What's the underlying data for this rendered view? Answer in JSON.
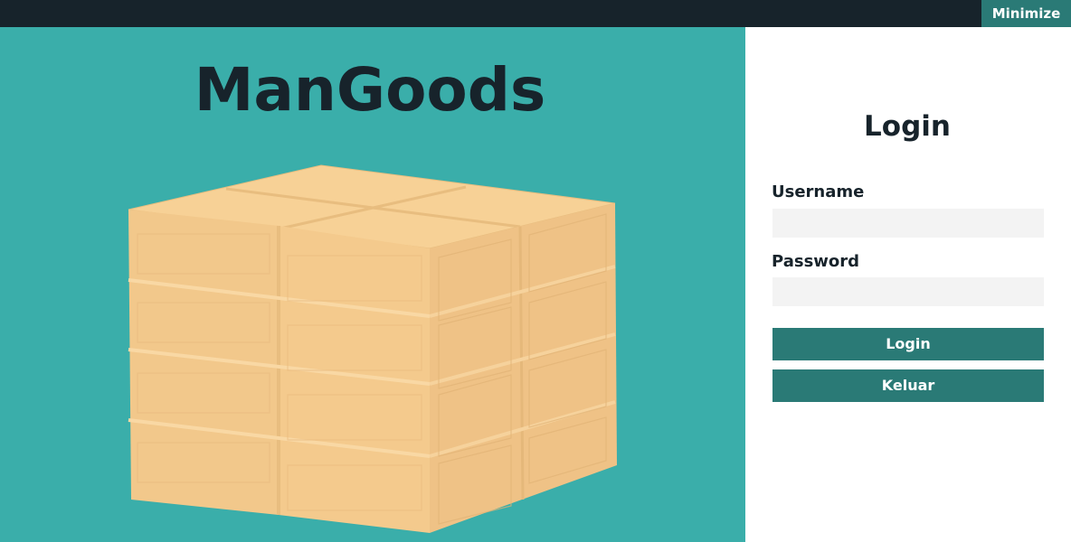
{
  "topbar": {
    "minimize_label": "Minimize"
  },
  "brand": {
    "title": "ManGoods",
    "illustration_icon": "stacked-wooden-crates-icon"
  },
  "login": {
    "title": "Login",
    "username_label": "Username",
    "username_value": "",
    "username_placeholder": "",
    "password_label": "Password",
    "password_value": "",
    "password_placeholder": "",
    "login_button": "Login",
    "exit_button": "Keluar"
  },
  "colors": {
    "topbar": "#17232b",
    "accent": "#2a7a76",
    "left_panel": "#3aaeaa",
    "input_bg": "#f3f3f3",
    "crate_light": "#f7cf94",
    "crate_dark": "#edc48a"
  }
}
